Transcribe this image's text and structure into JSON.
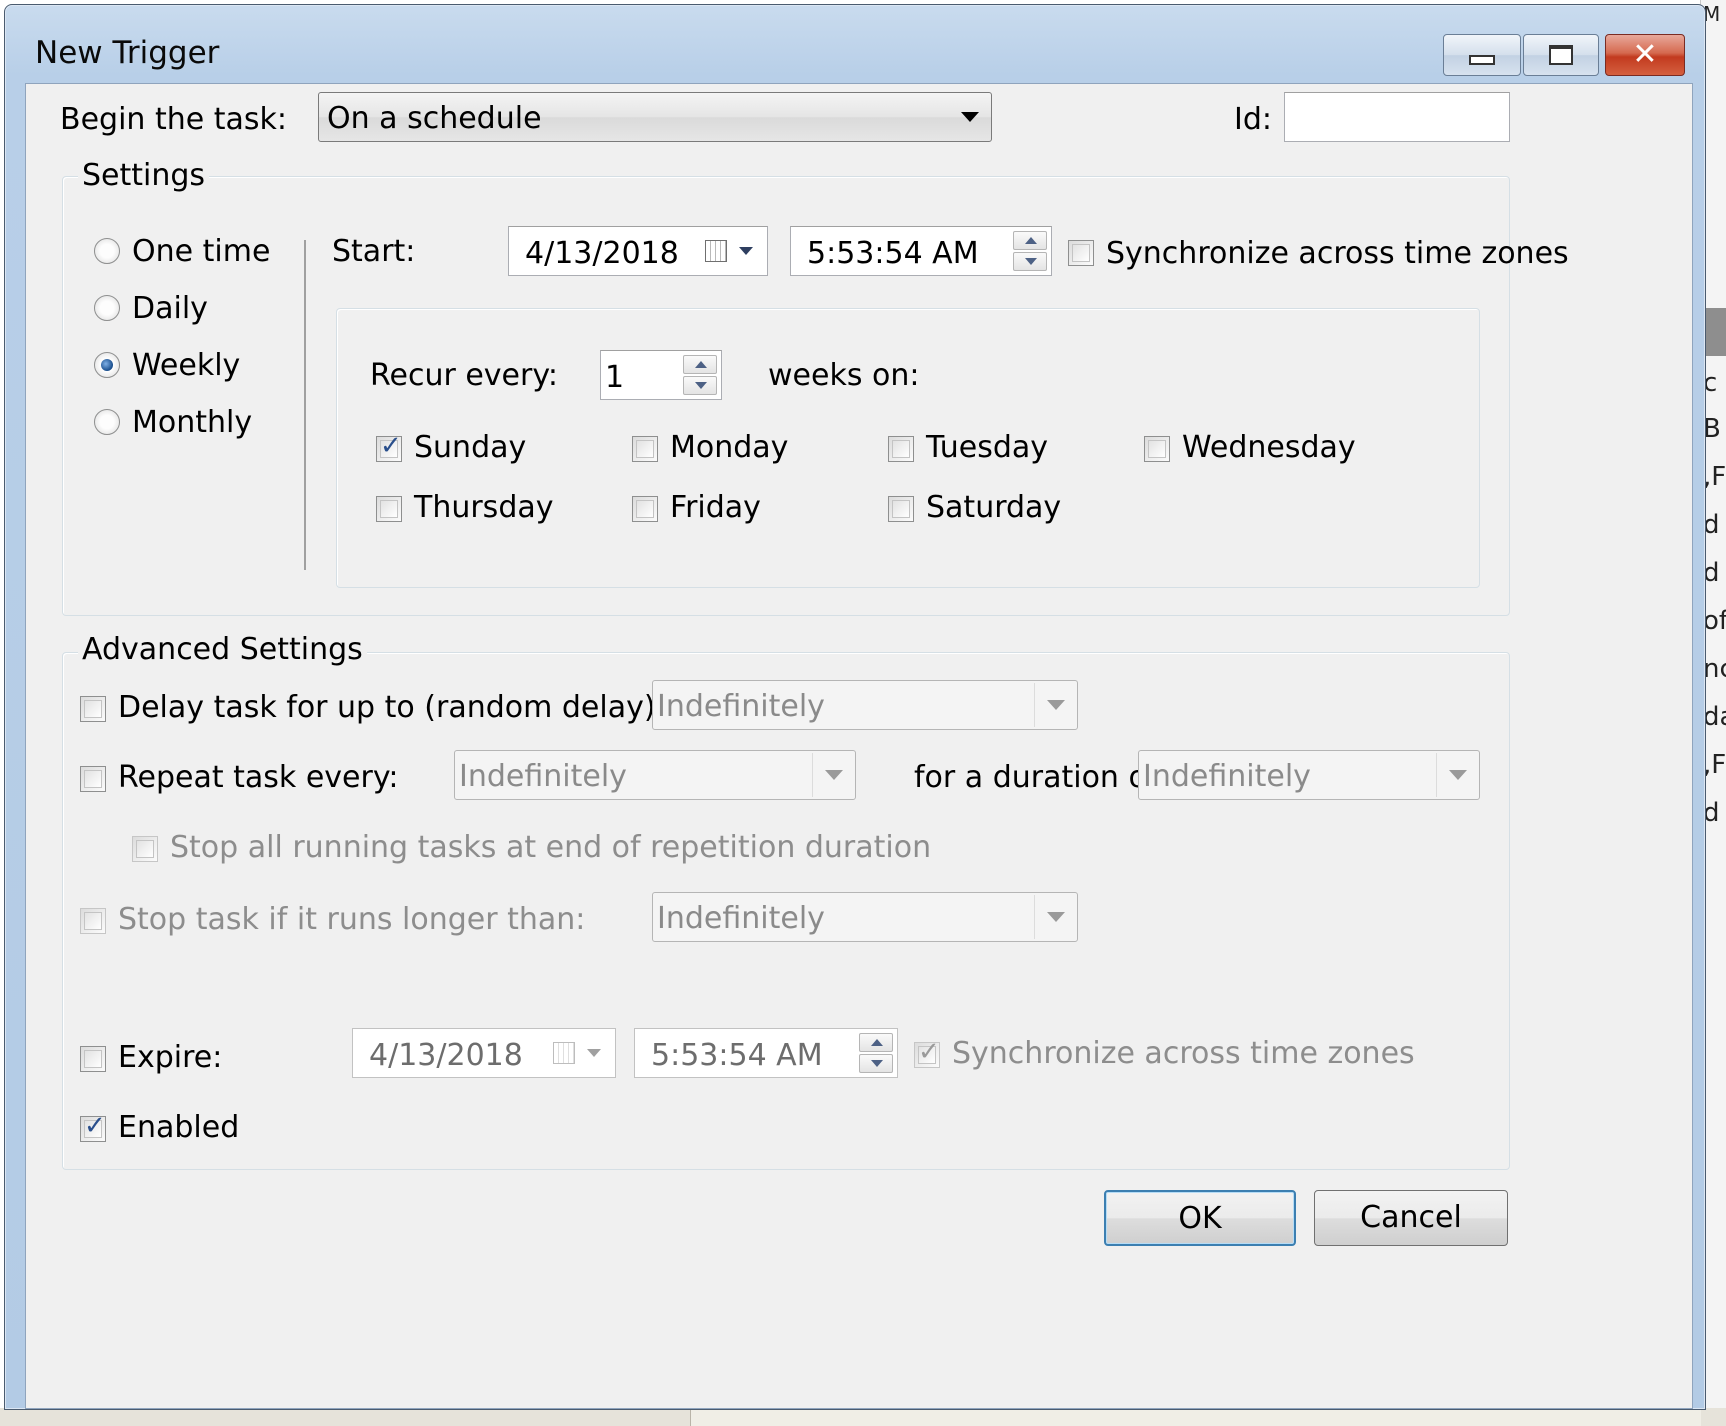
{
  "background": {
    "right_strip_text": [
      "c",
      "B",
      ",F",
      "d",
      "d",
      "of",
      "nc",
      "da",
      ",F",
      "d"
    ],
    "top_corner_text": "M"
  },
  "window": {
    "title": "New Trigger"
  },
  "begin": {
    "label": "Begin the task:",
    "value": "On a schedule",
    "id_label": "Id:",
    "id_value": ""
  },
  "settings": {
    "title": "Settings",
    "schedule_options": [
      "One time",
      "Daily",
      "Weekly",
      "Monthly"
    ],
    "selected": "Weekly",
    "start_label": "Start:",
    "start_date": "4/13/2018",
    "start_time": "5:53:54 AM",
    "sync_label": "Synchronize across time zones",
    "sync_checked": false,
    "recur_label": "Recur every:",
    "recur_value": "1",
    "weeks_on_label": "weeks on:",
    "days": [
      {
        "name": "Sunday",
        "checked": true
      },
      {
        "name": "Monday",
        "checked": false
      },
      {
        "name": "Tuesday",
        "checked": false
      },
      {
        "name": "Wednesday",
        "checked": false
      },
      {
        "name": "Thursday",
        "checked": false
      },
      {
        "name": "Friday",
        "checked": false
      },
      {
        "name": "Saturday",
        "checked": false
      }
    ]
  },
  "advanced": {
    "title": "Advanced Settings",
    "delay_label": "Delay task for up to (random delay):",
    "delay_value": "Indefinitely",
    "repeat_label": "Repeat task every:",
    "repeat_value": "Indefinitely",
    "duration_label": "for a duration of:",
    "duration_value": "Indefinitely",
    "stop_all_label": "Stop all running tasks at end of repetition duration",
    "stop_if_label": "Stop task if it runs longer than:",
    "stop_if_value": "Indefinitely",
    "expire_label": "Expire:",
    "expire_date": "4/13/2018",
    "expire_time": "5:53:54 AM",
    "expire_sync_label": "Synchronize across time zones",
    "expire_sync_checked": true,
    "enabled_label": "Enabled",
    "enabled_checked": true
  },
  "buttons": {
    "ok": "OK",
    "cancel": "Cancel"
  },
  "colors": {
    "title_bar": "#b8cfe8",
    "client_bg": "#f0f0f0",
    "close_button": "#c23a1f",
    "checkmark": "#2a4f8c",
    "default_button_border": "#3c7fb1"
  }
}
